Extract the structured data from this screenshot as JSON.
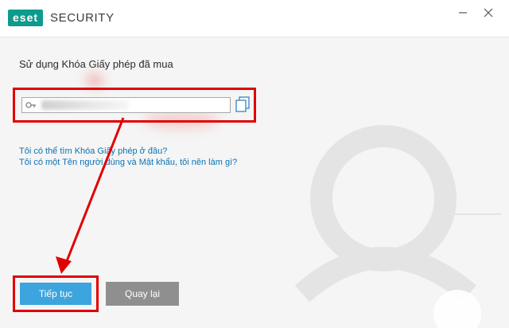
{
  "titlebar": {
    "logo": "eset",
    "app_name": "SECURITY",
    "minimize_icon": "minimize-icon",
    "close_icon": "close-icon"
  },
  "main": {
    "heading": "Sử dụng Khóa Giấy phép đã mua",
    "license_input": {
      "value": "",
      "icon": "key-icon"
    },
    "paste_icon": "copy-icon",
    "links": [
      "Tôi có thể tìm Khóa Giấy phép ở đâu?",
      "Tôi có một Tên người dùng và Mật khẩu, tôi nên làm gì?"
    ]
  },
  "footer": {
    "continue_label": "Tiếp tục",
    "back_label": "Quay lại"
  },
  "colors": {
    "brand": "#0e9a8e",
    "primary_button": "#3da5dd",
    "secondary_button": "#8f8f8f",
    "highlight": "#e10000",
    "link": "#0b72b5"
  }
}
